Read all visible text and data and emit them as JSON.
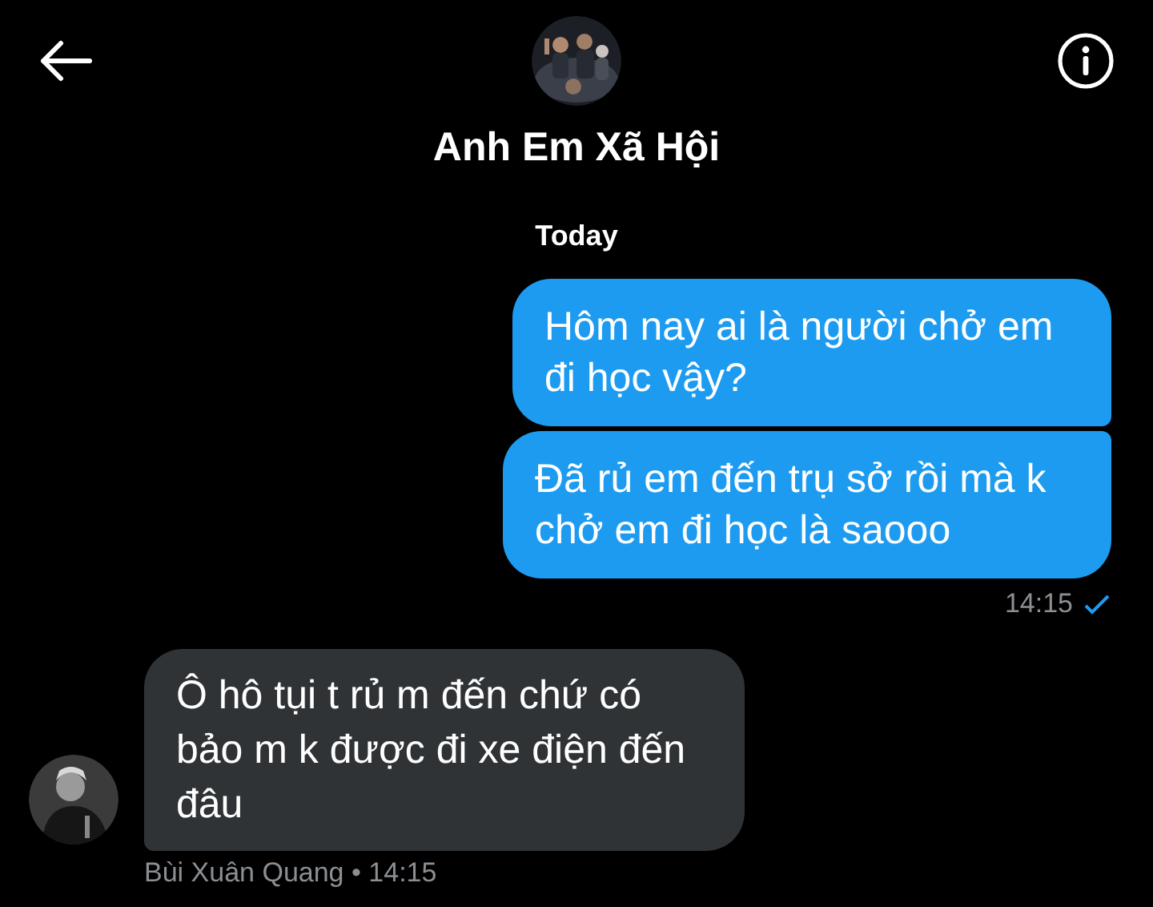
{
  "header": {
    "title": "Anh Em Xã Hội"
  },
  "day_label": "Today",
  "messages": [
    {
      "kind": "sent",
      "text": "Hôm nay ai là người chở em đi học vậy?"
    },
    {
      "kind": "sent",
      "text": "Đã rủ em đến trụ sở rồi mà k chở em đi học là saooo"
    },
    {
      "kind": "status",
      "time": "14:15",
      "read": true
    },
    {
      "kind": "received",
      "text": "Ô hô tụi t rủ m đến chứ có bảo m k được đi xe điện đến đâu",
      "sender": "Bùi Xuân Quang",
      "separator": "•",
      "time": "14:15"
    }
  ]
}
